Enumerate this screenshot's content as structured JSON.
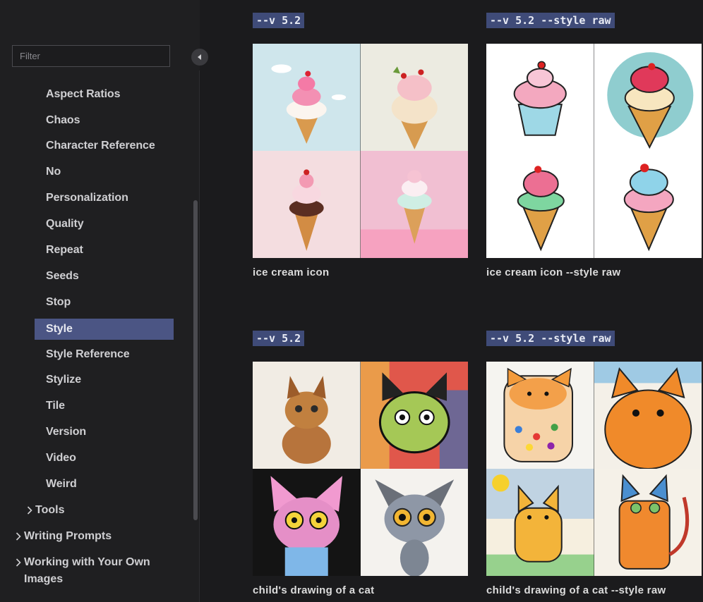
{
  "sidebar": {
    "filter_placeholder": "Filter",
    "items": [
      {
        "label": "Aspect Ratios"
      },
      {
        "label": "Chaos"
      },
      {
        "label": "Character Reference"
      },
      {
        "label": "No"
      },
      {
        "label": "Personalization"
      },
      {
        "label": "Quality"
      },
      {
        "label": "Repeat"
      },
      {
        "label": "Seeds"
      },
      {
        "label": "Stop"
      },
      {
        "label": "Style"
      },
      {
        "label": "Style Reference"
      },
      {
        "label": "Stylize"
      },
      {
        "label": "Tile"
      },
      {
        "label": "Version"
      },
      {
        "label": "Video"
      },
      {
        "label": "Weird"
      }
    ],
    "active_item": "Style",
    "groups": [
      {
        "label": "Tools"
      },
      {
        "label": "Writing Prompts"
      },
      {
        "label": "Working with Your Own Images"
      }
    ]
  },
  "examples": [
    {
      "tag": "--v 5.2",
      "caption": "ice cream icon",
      "subject": "ice-cream",
      "style": "default"
    },
    {
      "tag": "--v 5.2 --style raw",
      "caption": "ice cream icon --style raw",
      "subject": "ice-cream",
      "style": "raw"
    },
    {
      "tag": "--v 5.2",
      "caption": "child's drawing of a cat",
      "subject": "cat",
      "style": "default"
    },
    {
      "tag": "--v 5.2 --style raw",
      "caption": "child's drawing of a cat --style raw",
      "subject": "cat",
      "style": "raw"
    }
  ],
  "colors": {
    "background": "#1b1b1d",
    "sidebar_active": "#4b5584",
    "tag_bg": "#3f4b78"
  }
}
